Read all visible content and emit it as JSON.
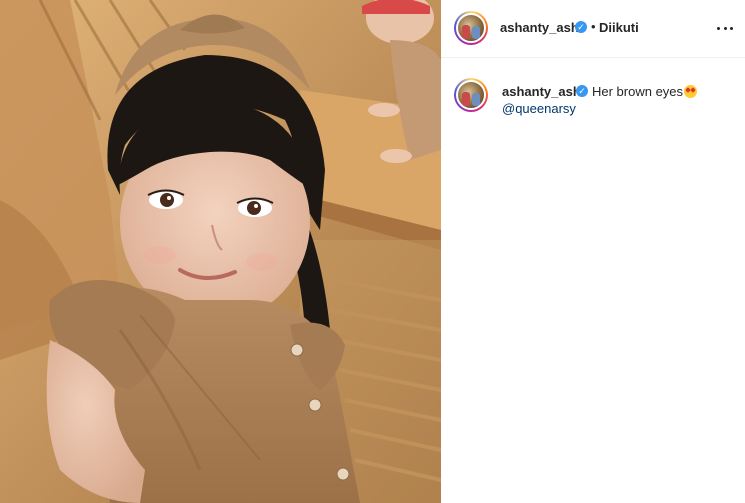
{
  "post": {
    "author": {
      "username": "ashanty_ash",
      "verified": true,
      "follow_separator": "•",
      "follow_status": "Diikuti"
    },
    "more_icon": "more-horizontal-icon",
    "caption": {
      "username": "ashanty_ash",
      "text": "Her brown eyes",
      "emoji": "star-struck-emoji",
      "mention": "@queenarsy"
    },
    "image": {
      "subject": "photo"
    }
  },
  "colors": {
    "verified_badge": "#3897f0",
    "mention": "#00376b",
    "text": "#262626",
    "border": "#efefef"
  }
}
